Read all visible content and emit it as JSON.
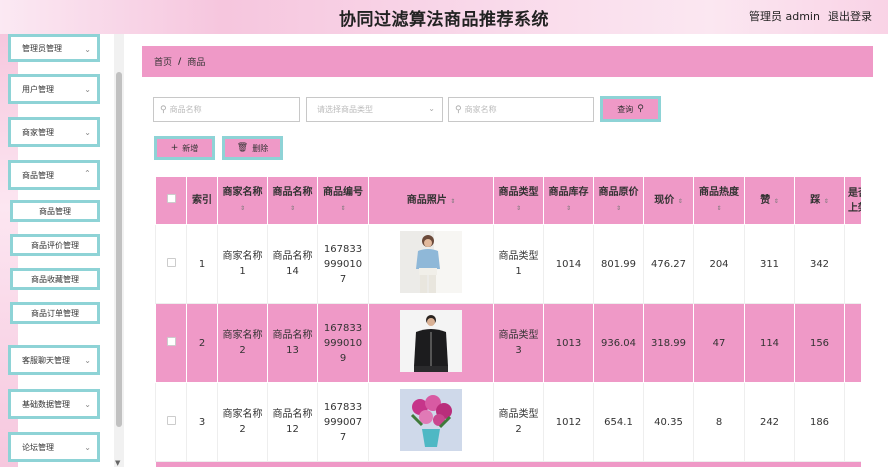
{
  "header": {
    "title": "协同过滤算法商品推荐系统",
    "user": "管理员 admin",
    "logout": "退出登录"
  },
  "sidebar": {
    "items": [
      {
        "label": "管理员管理"
      },
      {
        "label": "用户管理"
      },
      {
        "label": "商家管理"
      },
      {
        "label": "商品管理"
      }
    ],
    "sub_items": [
      {
        "label": "商品管理"
      },
      {
        "label": "商品评价管理"
      },
      {
        "label": "商品收藏管理"
      },
      {
        "label": "商品订单管理"
      }
    ],
    "items_after": [
      {
        "label": "客服聊天管理"
      },
      {
        "label": "基础数据管理"
      },
      {
        "label": "论坛管理"
      }
    ]
  },
  "breadcrumb": {
    "home": "首页",
    "separator": "/",
    "current": "商品"
  },
  "search": {
    "product_name_placeholder": "商品名称",
    "type_placeholder": "请选择商品类型",
    "merchant_name_placeholder": "商家名称",
    "query_label": "查询"
  },
  "actions": {
    "add_label": "新增",
    "delete_label": "删除"
  },
  "table": {
    "headers": [
      "索引",
      "商家名称",
      "商品名称",
      "商品编号",
      "商品照片",
      "商品类型",
      "商品库存",
      "商品原价",
      "现价",
      "商品热度",
      "赞",
      "踩",
      "是否上架"
    ],
    "rows": [
      {
        "index": "1",
        "merchant": "商家名称1",
        "product": "商品名称14",
        "code": "1678339990107",
        "photo": "woman-blue-shirt-photo",
        "type": "商品类型1",
        "stock": "1014",
        "original_price": "801.99",
        "price": "476.27",
        "heat": "204",
        "likes": "311",
        "dislikes": "342",
        "extra": ""
      },
      {
        "index": "2",
        "merchant": "商家名称2",
        "product": "商品名称13",
        "code": "1678339990109",
        "photo": "man-black-jacket-photo",
        "type": "商品类型3",
        "stock": "1013",
        "original_price": "936.04",
        "price": "318.99",
        "heat": "47",
        "likes": "114",
        "dislikes": "156",
        "extra": ""
      },
      {
        "index": "3",
        "merchant": "商家名称2",
        "product": "商品名称12",
        "code": "1678339990077",
        "photo": "flower-bouquet-photo",
        "type": "商品类型2",
        "stock": "1012",
        "original_price": "654.1",
        "price": "40.35",
        "heat": "8",
        "likes": "242",
        "dislikes": "186",
        "extra": ""
      }
    ]
  },
  "colors": {
    "accent_pink": "#ef99c7",
    "border_teal": "#8ed3d6",
    "header_gradient": "#f6c6de"
  },
  "icons": {
    "chevron": "chevron-down-icon",
    "search": "search-icon",
    "plus": "plus-icon",
    "trash": "trash-icon"
  }
}
